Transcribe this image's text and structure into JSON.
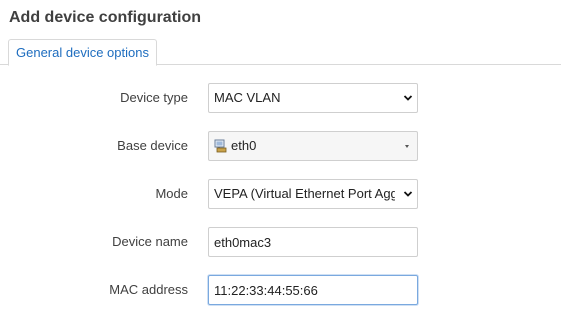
{
  "title": "Add device configuration",
  "tabs": [
    {
      "label": "General device options",
      "active": true
    }
  ],
  "fields": {
    "device_type": {
      "label": "Device type",
      "value": "MAC VLAN"
    },
    "base_device": {
      "label": "Base device",
      "value": "eth0",
      "icon": "network-device-icon"
    },
    "mode": {
      "label": "Mode",
      "value": "VEPA (Virtual Ethernet Port Aggregator)"
    },
    "device_name": {
      "label": "Device name",
      "value": "eth0mac3"
    },
    "mac_address": {
      "label": "MAC address",
      "value": "11:22:33:44:55:66"
    }
  },
  "colors": {
    "accent": "#1e6dbf",
    "focus_border": "#7aa9df"
  }
}
